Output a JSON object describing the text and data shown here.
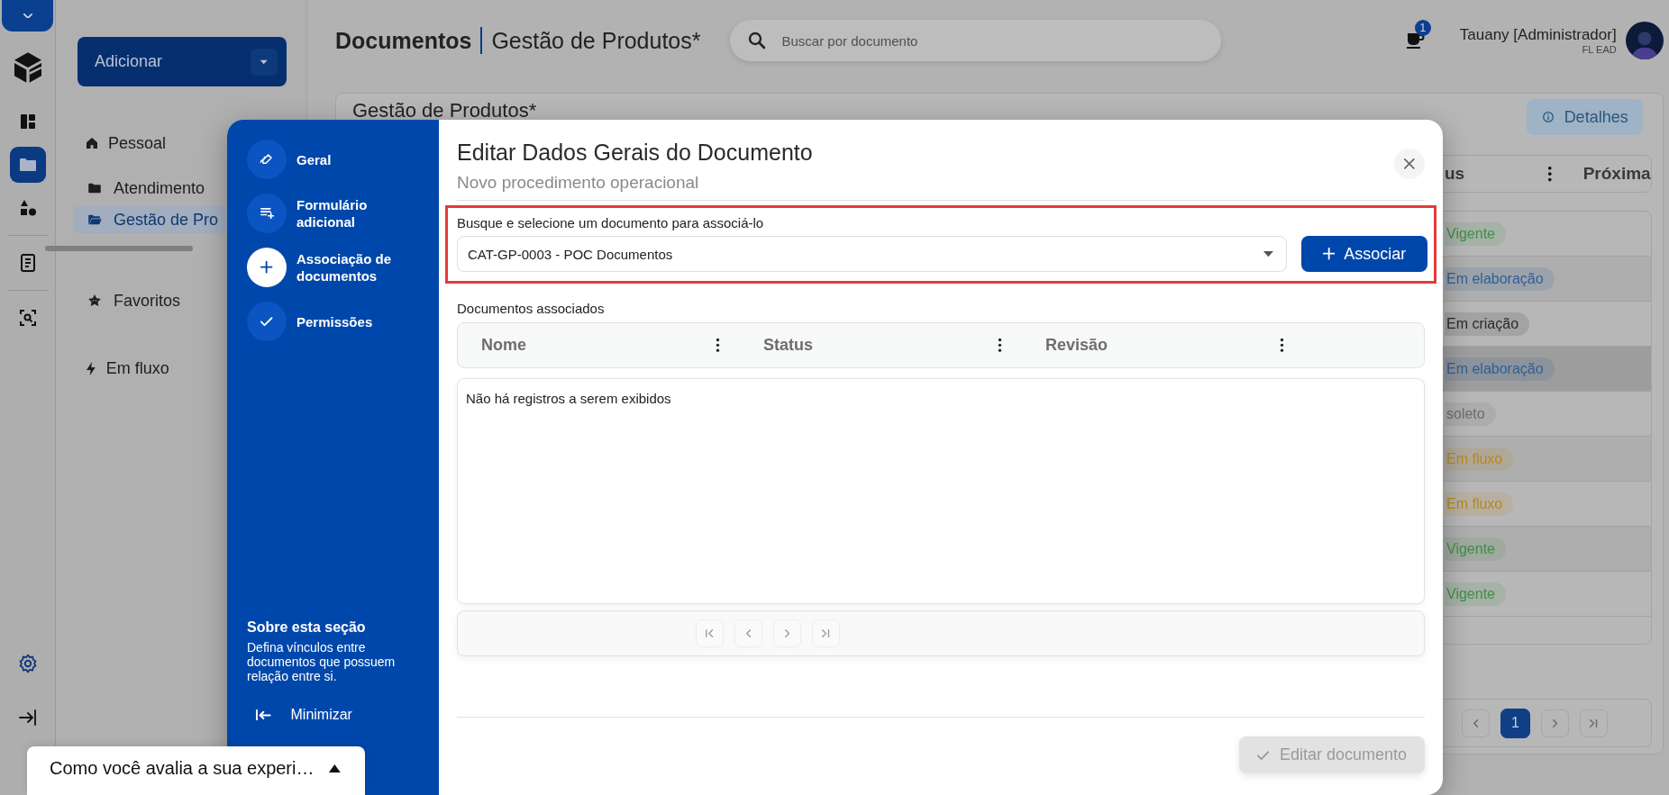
{
  "rail": {
    "items": [
      {
        "kind": "dashboard",
        "selected": false
      },
      {
        "kind": "folder",
        "selected": true
      },
      {
        "kind": "shapes",
        "selected": false
      },
      {
        "kind": "document",
        "selected": false
      },
      {
        "kind": "scan",
        "selected": false
      }
    ],
    "bottom": [
      {
        "kind": "settings"
      },
      {
        "kind": "logout"
      }
    ]
  },
  "nav": {
    "add_button": "Adicionar",
    "items": [
      {
        "label": "Pessoal",
        "kind": "home",
        "selected": false
      },
      {
        "label": "Atendimento",
        "kind": "folder",
        "selected": false
      },
      {
        "label": "Gestão de Pro",
        "kind": "folder-open",
        "selected": true
      }
    ],
    "shortcuts": [
      {
        "label": "Favoritos",
        "kind": "star"
      },
      {
        "label": "Em fluxo",
        "kind": "bolt"
      }
    ]
  },
  "header": {
    "title": "Documentos",
    "subtitle": "Gestão de Produtos*",
    "search_placeholder": "Buscar por documento",
    "notification_count": "1",
    "user_name": "Tauany [Administrador]",
    "user_org": "FL EAD"
  },
  "card": {
    "title": "Gestão de Produtos*",
    "details_button": "Detalhes",
    "columns": [
      "us",
      "Próxima"
    ],
    "rows": [
      {
        "status": "Vigente",
        "color": "#3f8f46",
        "selected": false
      },
      {
        "status": "Em elaboração",
        "color": "#2e5f94",
        "selected": false
      },
      {
        "status": "Em criação",
        "color": "#2a2a2a",
        "selected": false
      },
      {
        "status": "Em elaboração",
        "color": "#2e5f94",
        "selected": true
      },
      {
        "status": "soleto",
        "color": "#6b6b6b",
        "selected": false
      },
      {
        "status": "Em fluxo",
        "color": "#b8871c",
        "selected": false
      },
      {
        "status": "Em fluxo",
        "color": "#b8871c",
        "selected": false
      },
      {
        "status": "Vigente",
        "color": "#3f8f46",
        "selected": false
      },
      {
        "status": "Vigente",
        "color": "#3f8f46",
        "selected": false
      }
    ],
    "pagination": [
      {
        "kind": "prev",
        "selected": false
      },
      {
        "kind": "page",
        "label": "1",
        "selected": true
      },
      {
        "kind": "next",
        "selected": false
      },
      {
        "kind": "last",
        "selected": false
      }
    ]
  },
  "modal": {
    "steps": [
      {
        "label": "Geral",
        "kind": "pen",
        "selected": false
      },
      {
        "label": "Formulário adicional",
        "kind": "list-plus",
        "selected": false
      },
      {
        "label": "Associação de documentos",
        "kind": "plus",
        "selected": true
      },
      {
        "label": "Permissões",
        "kind": "check",
        "selected": false
      }
    ],
    "about_title": "Sobre esta seção",
    "about_text": "Defina vínculos entre documentos que possuem relação entre si.",
    "minimize": "Minimizar",
    "title": "Editar Dados Gerais do Documento",
    "subtitle": "Novo procedimento operacional",
    "field_label": "Busque e selecione um documento para associá-lo",
    "field_value": "CAT-GP-0003 - POC Documentos",
    "associate_button": "Associar",
    "section_label": "Documentos associados",
    "columns": [
      "Nome",
      "Status",
      "Revisão"
    ],
    "empty_text": "Não há registros a serem exibidos",
    "pager": [
      {
        "kind": "first",
        "disabled": true
      },
      {
        "kind": "prev",
        "disabled": true
      },
      {
        "kind": "next",
        "disabled": true
      },
      {
        "kind": "last",
        "disabled": true
      }
    ],
    "edit_button": {
      "label": "Editar documento",
      "disabled": true
    }
  },
  "survey": {
    "text": "Como você avalia a sua experi…"
  }
}
